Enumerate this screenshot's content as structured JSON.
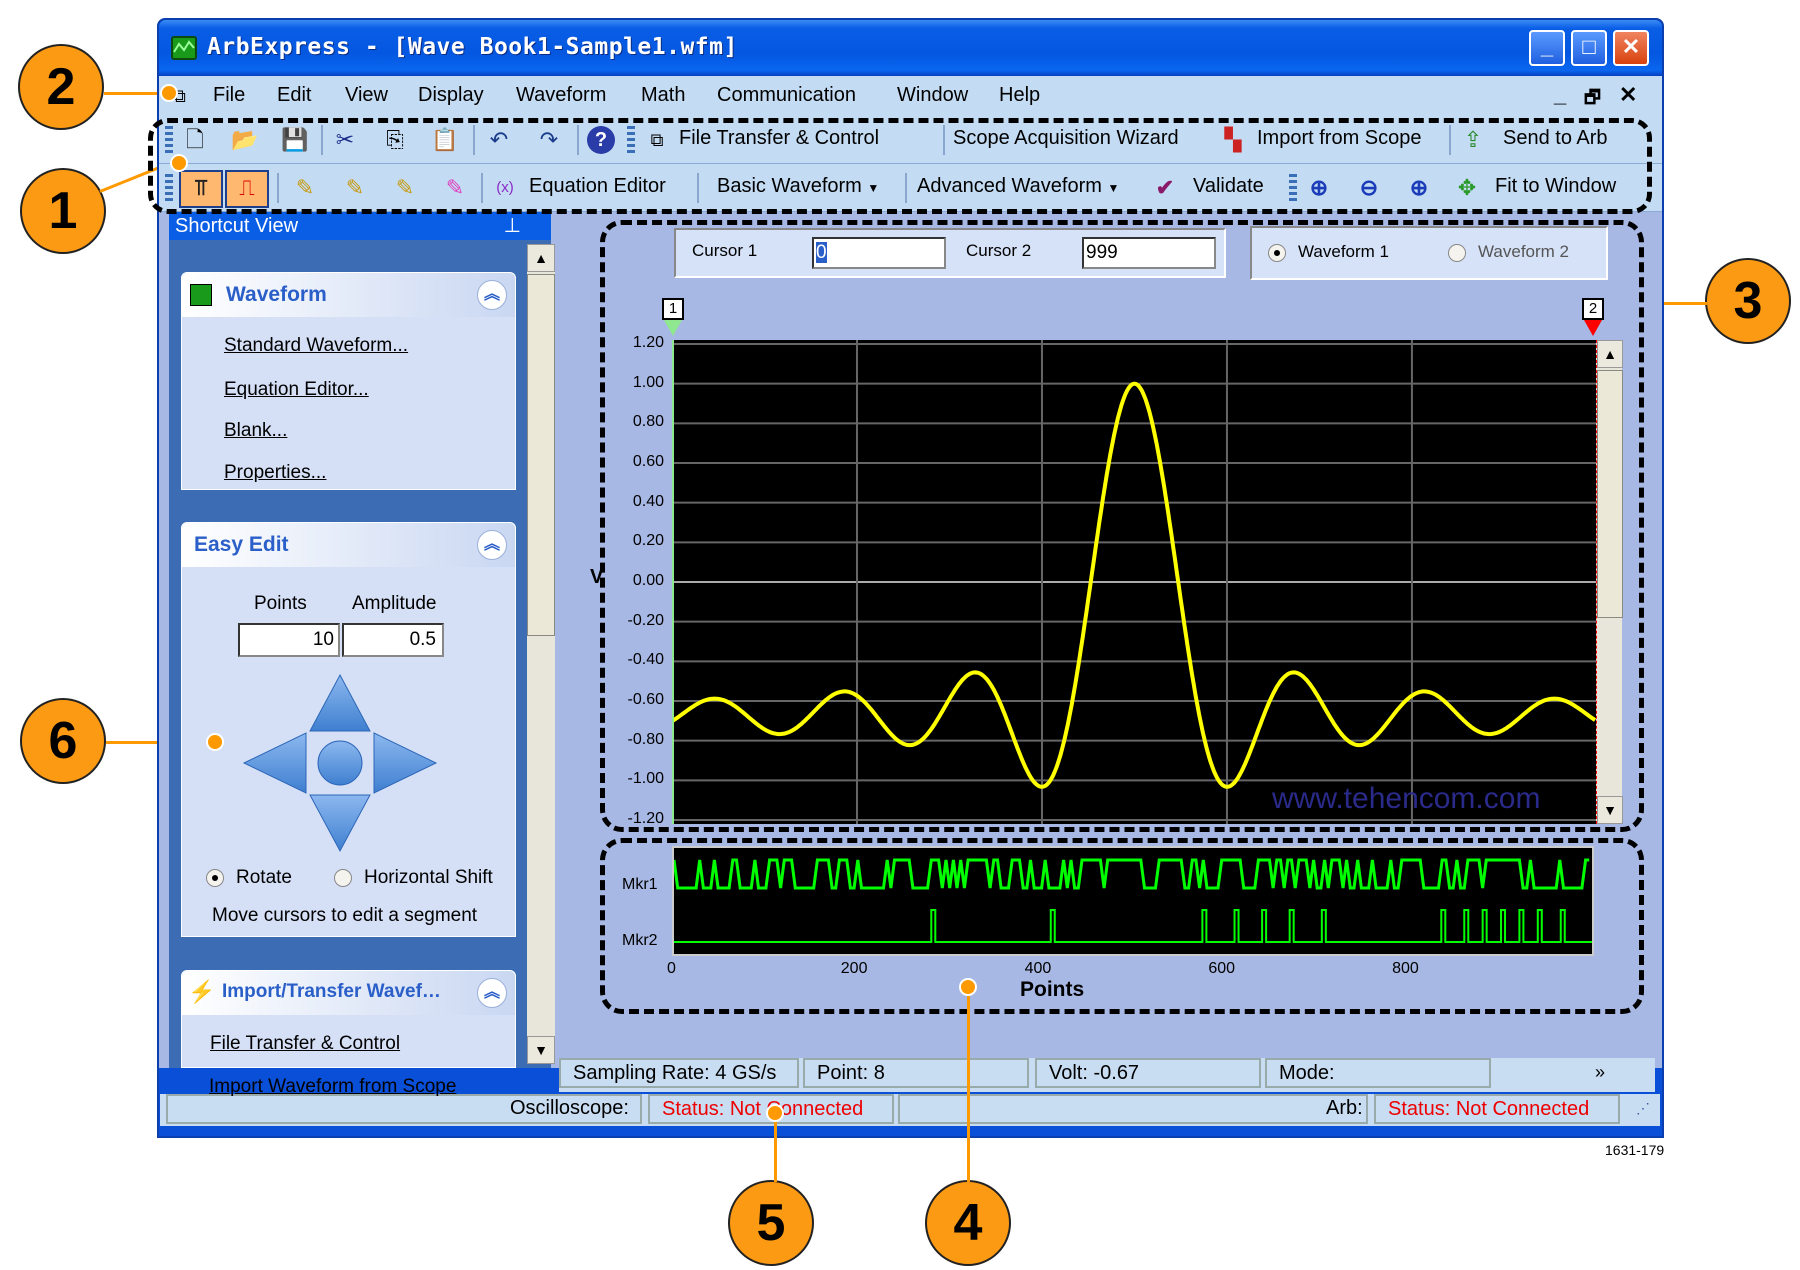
{
  "window": {
    "title": "ArbExpress - [Wave Book1-Sample1.wfm]",
    "icon": "waveform-app-icon",
    "caption_buttons": {
      "minimize": "_",
      "maximize": "□",
      "close": "✕"
    }
  },
  "menu": {
    "items": [
      "File",
      "Edit",
      "View",
      "Display",
      "Waveform",
      "Math",
      "Communication",
      "Window",
      "Help"
    ],
    "mdi_controls": {
      "minimize": "_",
      "restore": "🗗",
      "close": "✕"
    }
  },
  "toolbar1": {
    "icons": [
      "new-file-icon",
      "open-file-icon",
      "save-icon",
      "cut-icon",
      "copy-icon",
      "paste-icon",
      "undo-icon",
      "redo-icon",
      "help-icon"
    ],
    "file_transfer": "File Transfer & Control",
    "scope_wizard": "Scope Acquisition Wizard",
    "import_scope": "Import from Scope",
    "send_arb": "Send to Arb"
  },
  "toolbar2": {
    "equation_editor": "Equation Editor",
    "basic_waveform": "Basic Waveform",
    "advanced_waveform": "Advanced Waveform",
    "validate": "Validate",
    "fit_window": "Fit to Window"
  },
  "shortcut_view": {
    "title": "Shortcut View",
    "pin": "⊥",
    "waveform_panel": {
      "title": "Waveform",
      "links": [
        "Standard Waveform...",
        "Equation Editor...",
        "Blank...",
        "Properties..."
      ]
    },
    "easy_edit": {
      "title": "Easy Edit",
      "points_label": "Points",
      "amplitude_label": "Amplitude",
      "points_value": "10",
      "amplitude_value": "0.5",
      "rotate_label": "Rotate",
      "hshift_label": "Horizontal Shift",
      "mode_selected": "Rotate",
      "hint": "Move cursors to edit a segment"
    },
    "import_panel": {
      "title": "Import/Transfer Wavef…",
      "links": [
        "File Transfer & Control",
        "Import Waveform from Scope"
      ]
    }
  },
  "cursors": {
    "cursor1_label": "Cursor 1",
    "cursor1_value": "0",
    "cursor2_label": "Cursor 2",
    "cursor2_value": "999",
    "waveform1": "Waveform 1",
    "waveform2": "Waveform 2",
    "selected_waveform": "Waveform 1",
    "marker1": "1",
    "marker2": "2"
  },
  "chart_data": {
    "type": "line",
    "ylabel": "V",
    "xlabel": "Points",
    "ylim": [
      -1.2,
      1.2
    ],
    "xlim": [
      0,
      999
    ],
    "yticks": [
      "1.20",
      "1.00",
      "0.80",
      "0.60",
      "0.40",
      "0.20",
      "0.00",
      "-0.20",
      "-0.40",
      "-0.60",
      "-0.80",
      "-1.00",
      "-1.20"
    ],
    "xticks": [
      "0",
      "200",
      "400",
      "600",
      "800"
    ],
    "grid": true,
    "series": [
      {
        "name": "Waveform 1",
        "color": "#ffff00",
        "description": "sinc pulse: offset -0.67 + 1.67*sinc, peak 1.00 at point 500, first nulls -1.00 near 430 and 570"
      }
    ],
    "peak": {
      "x": 500,
      "y": 1.0
    },
    "markers": [
      {
        "name": "Mkr1",
        "color": "#00ff00",
        "density": "dense random"
      },
      {
        "name": "Mkr2",
        "color": "#00ff00",
        "pulses": [
          280,
          410,
          575,
          610,
          640,
          670,
          705,
          835,
          860,
          880,
          900,
          920,
          940,
          965
        ]
      }
    ],
    "watermark": "www.tehencom.com"
  },
  "status": {
    "sampling_rate": "Sampling Rate: 4 GS/s",
    "point": "Point: 8",
    "volt": "Volt: -0.67",
    "mode": "Mode:",
    "oscilloscope_label": "Oscilloscope:",
    "oscilloscope_status": "Status: Not Connected",
    "arb_label": "Arb:",
    "arb_status": "Status: Not Connected"
  },
  "callouts": [
    "1",
    "2",
    "3",
    "4",
    "5",
    "6"
  ],
  "figure_id": "1631-179"
}
